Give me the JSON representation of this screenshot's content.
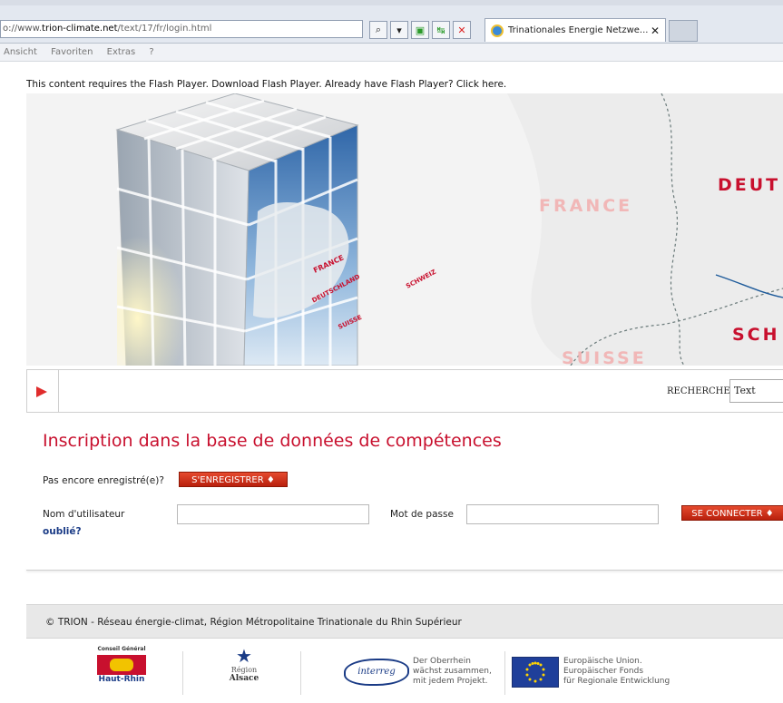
{
  "browser": {
    "url_prefix": "o://www.",
    "url_host": "trion-climate.net",
    "url_path": "/text/17/fr/login.html",
    "tab_title": "Trinationales Energie Netzwe...",
    "menu": [
      "Ansicht",
      "Favoriten",
      "Extras",
      "?"
    ]
  },
  "page": {
    "flash_message": "This content requires the Flash Player. Download Flash Player. Already have Flash Player? Click here.",
    "banner": {
      "map_labels": [
        "FRANCE",
        "DEUT",
        "SCH",
        "SUISSE"
      ],
      "cube_labels": [
        "FRANCE",
        "DEUTSCHLAND",
        "SUISSE",
        "SCHWEIZ"
      ]
    },
    "search": {
      "label": "RECHERCHE",
      "value": "Text"
    },
    "heading": "Inscription dans la base de données de compétences",
    "register_prompt": "Pas encore enregistré(e)?",
    "register_button": "S'ENREGISTRER",
    "username_label": "Nom d'utilisateur",
    "password_label": "Mot de passe",
    "login_button": "SE CONNECTER",
    "forgot_link": "oublié?",
    "footer": "© TRION - Réseau énergie-climat, Région Métropolitaine Trinationale du Rhin Supérieur",
    "logos": {
      "haut_rhin_top": "Conseil Général",
      "haut_rhin_name": "Haut-Rhin",
      "alsace_line1": "Région",
      "alsace_line2": "Alsace",
      "interreg_name": "interreg",
      "interreg_text": [
        "Der Oberrhein",
        "wächst zusammen,",
        "mit jedem Projekt."
      ],
      "eu_text": [
        "Europäische Union.",
        "Europäischer Fonds",
        "für Regionale Entwicklung"
      ]
    },
    "colors": {
      "accent_red": "#c8102e",
      "button_red": "#d23a1f",
      "link_blue": "#1a3b86"
    }
  }
}
